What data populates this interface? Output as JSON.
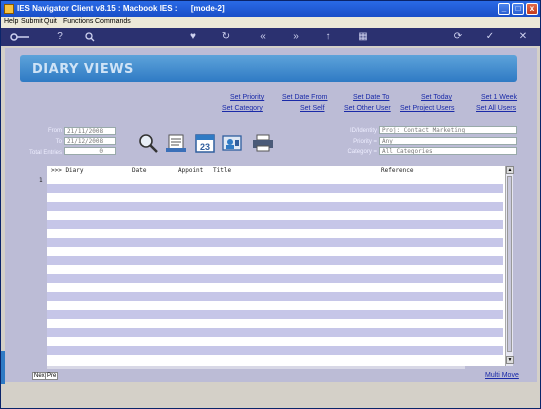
{
  "window": {
    "title": "IES Navigator Client v8.15 : Macbook IES :      [mode-2]",
    "controls": {
      "minimize": "_",
      "maximize": "□",
      "close": "x"
    }
  },
  "menu": [
    "Help",
    "Submit",
    "Quit",
    "Functions",
    "Commands"
  ],
  "banner": {
    "title": "DIARY VIEWS"
  },
  "links": {
    "set_priority": "Set Priority",
    "set_category": "Set Category",
    "set_date_from": "Set Date From",
    "set_self": "Set Self",
    "set_date_to": "Set Date To",
    "set_other_user": "Set Other User",
    "set_today": "Set Today",
    "set_project_users": "Set Project Users",
    "set_1_week": "Set 1 Week",
    "set_all_users": "Set All Users",
    "multi_move": "Multi Move"
  },
  "fields": {
    "from_label": "From",
    "from_value": "21/11/2008",
    "to_label": "To",
    "to_value": "21/12/2008",
    "total_entries_label": "Total Entries",
    "total_entries_value": "0",
    "id_label": "ID/Identity",
    "id_value": "Proj: Contact Marketing",
    "priority_label": "Priority =",
    "priority_value": "Any",
    "category_label": "Category =",
    "category_value": "All Categories"
  },
  "calendar_icon_day": "23",
  "grid": {
    "columns": [
      ">>> Diary",
      "Date",
      "Appoint",
      "Title",
      "Reference"
    ],
    "first_row_number": "1"
  },
  "nav": {
    "next": "Nex",
    "prev": "Pre"
  }
}
